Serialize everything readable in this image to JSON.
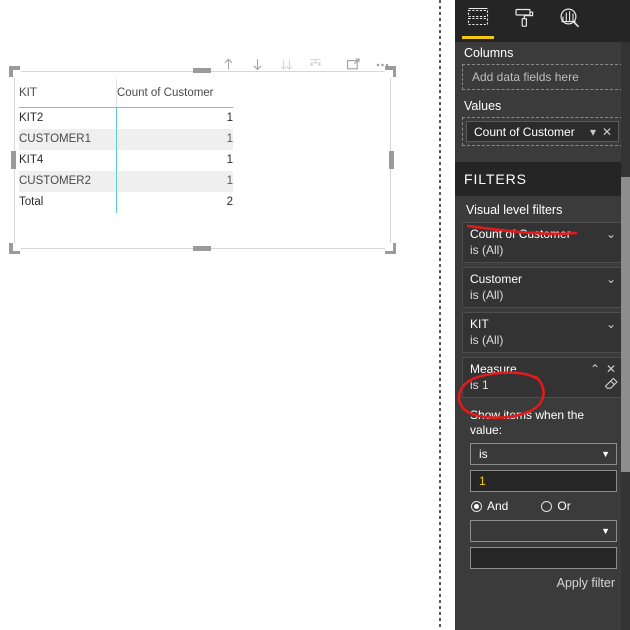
{
  "canvas": {
    "drill_toolbar": [
      {
        "name": "drill-up-button",
        "label": "Drill up",
        "icon": "arrow-up-icon",
        "enabled": true
      },
      {
        "name": "drill-down-button",
        "label": "Drill down",
        "icon": "arrow-down-icon",
        "enabled": true
      },
      {
        "name": "expand-all-button",
        "label": "Expand all down one level in the hierarchy",
        "icon": "double-arrow-down-icon",
        "enabled": false
      },
      {
        "name": "drill-mode-button",
        "label": "Go to the next level in the hierarchy",
        "icon": "fork-arrow-down-icon",
        "enabled": false
      },
      {
        "name": "focus-mode-button",
        "label": "Focus mode",
        "icon": "focus-expand-icon",
        "enabled": true
      },
      {
        "name": "more-options-button",
        "label": "More options",
        "icon": "ellipsis-icon",
        "enabled": true
      }
    ],
    "matrix": {
      "columns": [
        "KIT",
        "Count of Customer"
      ],
      "rows": [
        {
          "label": "KIT2",
          "value": "1",
          "level": 0,
          "alt": false,
          "total": false
        },
        {
          "label": "CUSTOMER1",
          "value": "1",
          "level": 1,
          "alt": true,
          "total": false
        },
        {
          "label": "KIT4",
          "value": "1",
          "level": 0,
          "alt": false,
          "total": false
        },
        {
          "label": "CUSTOMER2",
          "value": "1",
          "level": 1,
          "alt": true,
          "total": false
        },
        {
          "label": "Total",
          "value": "2",
          "level": 0,
          "alt": false,
          "total": true
        }
      ],
      "accent_color": "#5ccfcf",
      "alt_row_color": "#efefef"
    }
  },
  "pane": {
    "tabs": [
      {
        "name": "tab-fields",
        "icon": "fields-table-icon",
        "active": true
      },
      {
        "name": "tab-format",
        "icon": "paint-roller-icon",
        "active": false
      },
      {
        "name": "tab-analytics",
        "icon": "analytics-magnifier-icon",
        "active": false
      }
    ],
    "fields": {
      "columns_label": "Columns",
      "columns_dropzone_placeholder": "Add data fields here",
      "values_label": "Values",
      "values_fields": [
        {
          "name": "Count of Customer",
          "caret": "▾",
          "remove": "✕"
        }
      ]
    },
    "filters": {
      "header": "FILTERS",
      "group_title": "Visual level filters",
      "cards": [
        {
          "name": "Count of Customer",
          "state": "is (All)",
          "expanded": false,
          "chevron": "⌄"
        },
        {
          "name": "Customer",
          "state": "is (All)",
          "expanded": false,
          "chevron": "⌄"
        },
        {
          "name": "KIT",
          "state": "is (All)",
          "expanded": false,
          "chevron": "⌄"
        },
        {
          "name": "Measure",
          "state": "is 1",
          "expanded": true,
          "chevron": "⌃",
          "close": "✕",
          "clear_icon": "eraser-icon"
        }
      ],
      "advanced": {
        "prompt": "Show items when the value:",
        "operator_value": "is",
        "operator_caret": "▼",
        "operand_value": "1",
        "conjunction": [
          {
            "label": "And",
            "selected": true
          },
          {
            "label": "Or",
            "selected": false
          }
        ],
        "operator2_value": "",
        "operator2_caret": "▼",
        "operand2_value": "",
        "apply_label": "Apply filter"
      }
    },
    "colors": {
      "pane_bg": "#3b3b3b",
      "header_bg": "#252525",
      "accent_yellow": "#f2c811",
      "annotation_red": "#e01b1b"
    }
  }
}
